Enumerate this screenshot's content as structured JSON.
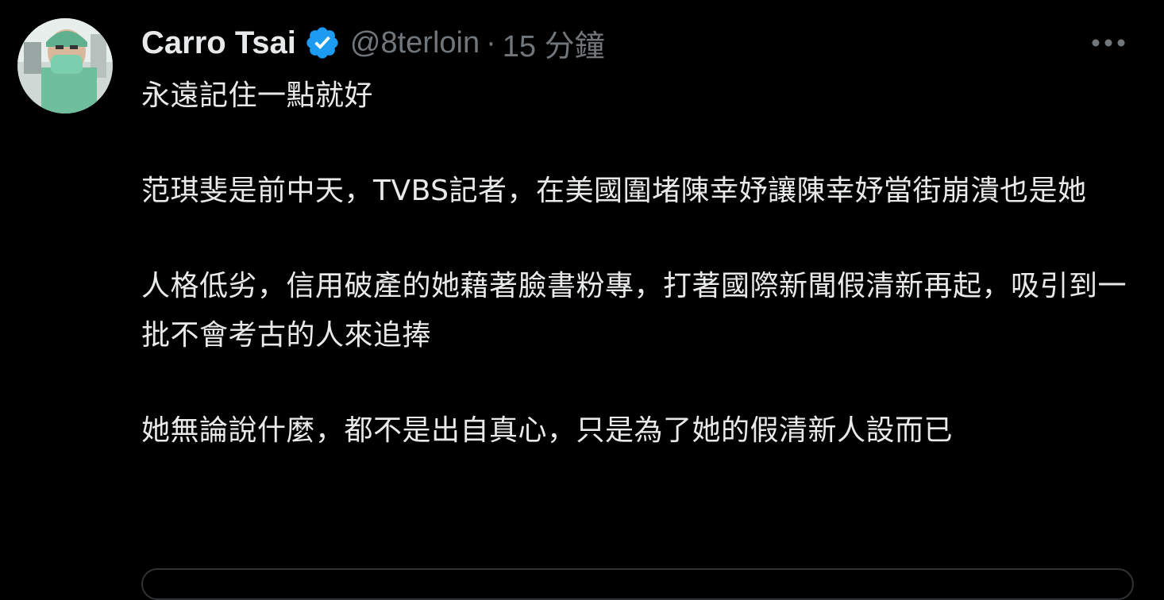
{
  "tweet": {
    "author": {
      "display_name": "Carro Tsai",
      "handle": "@8terloin",
      "verified": true,
      "verified_icon": "verified-badge-icon"
    },
    "separator": "·",
    "timestamp": "15 分鐘",
    "more_icon": "more-options-icon",
    "paragraphs": [
      "永遠記住一點就好",
      "范琪斐是前中天，TVBS記者，在美國圍堵陳幸妤讓陳幸妤當街崩潰也是她",
      "人格低劣，信用破產的她藉著臉書粉專，打著國際新聞假清新再起，吸引到一批不會考古的人來追捧",
      "她無論說什麼，都不是出自真心，只是為了她的假清新人設而已"
    ]
  },
  "colors": {
    "background": "#000000",
    "text_primary": "#e7e9ea",
    "text_secondary": "#71767b",
    "verified_blue": "#1d9bf0",
    "border": "#2f3336"
  }
}
